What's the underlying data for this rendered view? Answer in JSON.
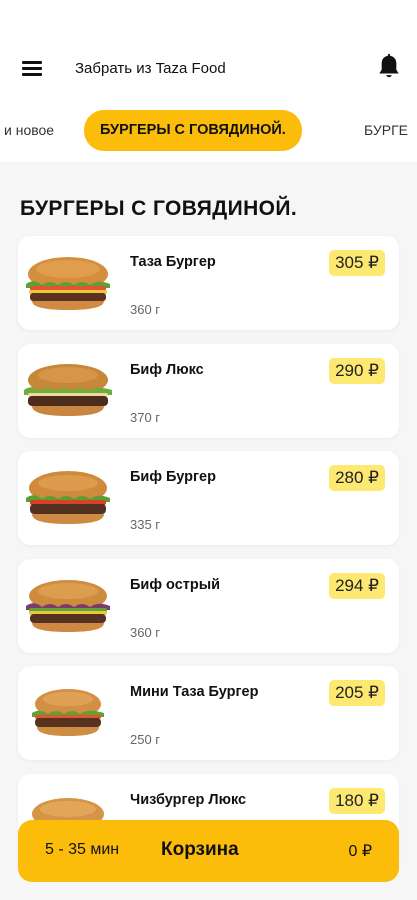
{
  "header": {
    "pickup_text": "Забрать из Taza Food"
  },
  "tabs": [
    {
      "label": "и новое",
      "active": false
    },
    {
      "label": "БУРГЕРЫ С ГОВЯДИНОЙ.",
      "active": true
    },
    {
      "label": "БУРГЕ",
      "active": false
    }
  ],
  "section": {
    "title": "БУРГЕРЫ С ГОВЯДИНОЙ."
  },
  "products": [
    {
      "name": "Таза Бургер",
      "weight": "360 г",
      "price": "305 ₽"
    },
    {
      "name": "Биф Люкс",
      "weight": "370 г",
      "price": "290 ₽"
    },
    {
      "name": "Биф Бургер",
      "weight": "335 г",
      "price": "280 ₽"
    },
    {
      "name": "Биф острый",
      "weight": "360 г",
      "price": "294 ₽"
    },
    {
      "name": "Мини Таза Бургер",
      "weight": "250 г",
      "price": "205 ₽"
    },
    {
      "name": "Чизбургер Люкс",
      "weight": "",
      "price": "180 ₽"
    }
  ],
  "cart": {
    "time": "5 - 35 мин",
    "label": "Корзина",
    "total": "0 ₽"
  },
  "colors": {
    "accent": "#fbbd09",
    "price_badge": "#fde872",
    "background": "#f6f6f6"
  },
  "icons": [
    "menu-icon",
    "bell-icon",
    "burger-image"
  ]
}
